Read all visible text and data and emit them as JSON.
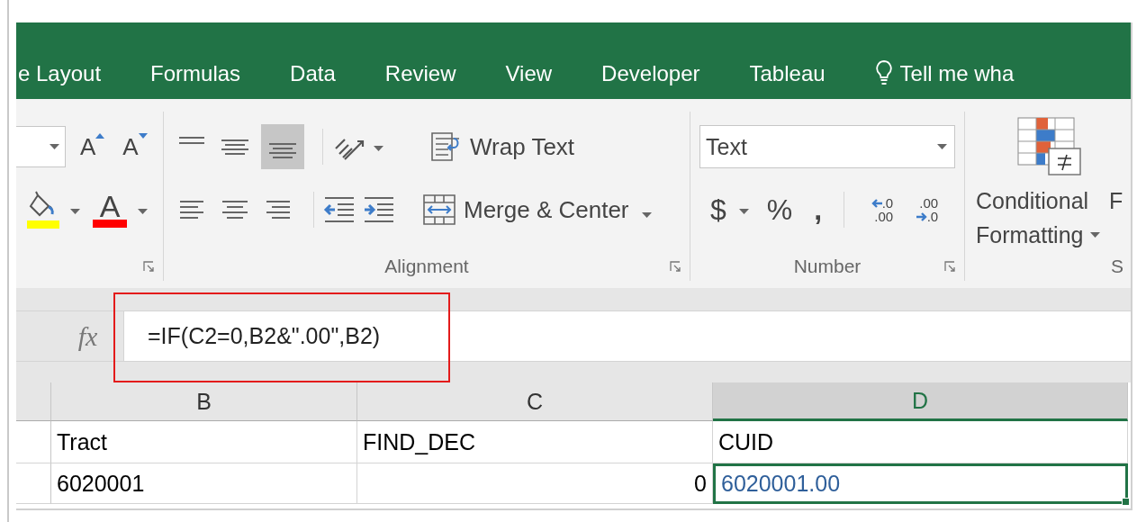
{
  "tabs": [
    {
      "label": "e Layout",
      "selected": false
    },
    {
      "label": "Formulas",
      "selected": false
    },
    {
      "label": "Data",
      "selected": false
    },
    {
      "label": "Review",
      "selected": false
    },
    {
      "label": "View",
      "selected": false
    },
    {
      "label": "Developer",
      "selected": false
    },
    {
      "label": "Tableau",
      "selected": false
    }
  ],
  "tell_me": {
    "label": "Tell me wha"
  },
  "ribbon": {
    "font_group": {
      "grow_font": "A",
      "shrink_font": "A",
      "fill_color": {
        "color": "#ffff00"
      },
      "font_color": {
        "letter": "A",
        "color": "#ff0000"
      }
    },
    "alignment_group": {
      "label": "Alignment",
      "vertical_align": [
        {
          "kind": "top",
          "selected": false
        },
        {
          "kind": "middle",
          "selected": false
        },
        {
          "kind": "bottom",
          "selected": true
        }
      ],
      "horizontal_align": [
        {
          "kind": "left",
          "selected": false
        },
        {
          "kind": "center",
          "selected": false
        },
        {
          "kind": "right",
          "selected": false
        }
      ],
      "wrap_text": "Wrap Text",
      "merge_center": "Merge & Center"
    },
    "number_group": {
      "label": "Number",
      "format": "Text",
      "currency": "$",
      "percent": "%",
      "comma": ",",
      "decimals": [
        {
          "kind": "increase",
          "top": ".0",
          "bottom": ".00"
        },
        {
          "kind": "decrease",
          "top": ".00",
          "bottom": ".0"
        }
      ]
    },
    "styles_group": {
      "conditional_formatting": [
        "Conditional",
        "Formatting"
      ],
      "next_button": "F",
      "label": "S"
    }
  },
  "formula_bar": {
    "fx": "fx",
    "formula": "=IF(C2=0,B2&\".00\",B2)",
    "highlighted": true
  },
  "sheet": {
    "columns": [
      {
        "label": "B",
        "selected": false
      },
      {
        "label": "C",
        "selected": false
      },
      {
        "label": "D",
        "selected": true
      }
    ],
    "rows": [
      {
        "cells": [
          {
            "text": "Tract",
            "kind": "text",
            "selected": false,
            "color": "#000000"
          },
          {
            "text": "FIND_DEC",
            "kind": "text",
            "selected": false,
            "color": "#000000"
          },
          {
            "text": "CUID",
            "kind": "text",
            "selected": false,
            "color": "#000000"
          }
        ]
      },
      {
        "cells": [
          {
            "text": "6020001",
            "kind": "text",
            "selected": false,
            "color": "#000000"
          },
          {
            "text": "0",
            "kind": "number",
            "selected": false,
            "color": "#000000"
          },
          {
            "text": "6020001.00",
            "kind": "text",
            "selected": true,
            "color": "#2f5f9a"
          }
        ]
      }
    ]
  }
}
